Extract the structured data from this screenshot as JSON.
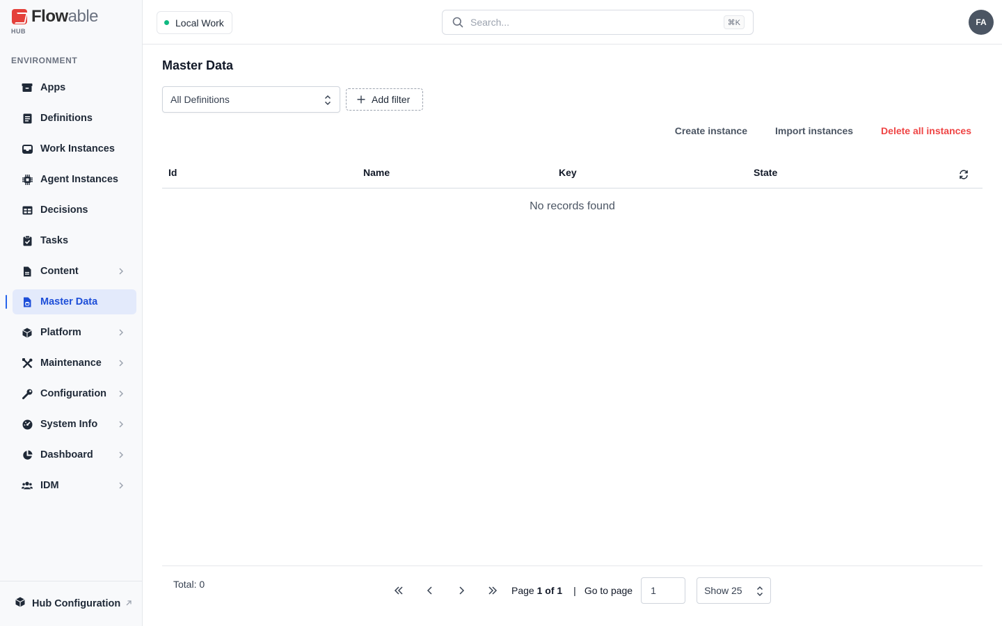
{
  "brand": {
    "name_part1": "Flow",
    "name_part2": "able",
    "sub": "HUB"
  },
  "sidebar": {
    "section_label": "ENVIRONMENT",
    "items": [
      {
        "label": "Apps",
        "icon": "box-icon",
        "chevron": false
      },
      {
        "label": "Definitions",
        "icon": "document-list-icon",
        "chevron": false
      },
      {
        "label": "Work Instances",
        "icon": "inbox-icon",
        "chevron": false
      },
      {
        "label": "Agent Instances",
        "icon": "chip-icon",
        "chevron": false
      },
      {
        "label": "Decisions",
        "icon": "table-icon",
        "chevron": false
      },
      {
        "label": "Tasks",
        "icon": "clipboard-check-icon",
        "chevron": false
      },
      {
        "label": "Content",
        "icon": "file-icon",
        "chevron": true
      },
      {
        "label": "Master Data",
        "icon": "database-file-icon",
        "chevron": false,
        "active": true
      },
      {
        "label": "Platform",
        "icon": "cube-icon",
        "chevron": true
      },
      {
        "label": "Maintenance",
        "icon": "tools-icon",
        "chevron": true
      },
      {
        "label": "Configuration",
        "icon": "wrench-icon",
        "chevron": true
      },
      {
        "label": "System Info",
        "icon": "gauge-icon",
        "chevron": true
      },
      {
        "label": "Dashboard",
        "icon": "pie-chart-icon",
        "chevron": true
      },
      {
        "label": "IDM",
        "icon": "users-icon",
        "chevron": true
      }
    ],
    "footer_label": "Hub Configuration"
  },
  "header": {
    "environment": "Local Work",
    "search_placeholder": "Search...",
    "search_shortcut": "⌘K",
    "avatar_initials": "FA"
  },
  "main": {
    "title": "Master Data",
    "definition_select": "All Definitions",
    "add_filter": "Add filter",
    "actions": {
      "create": "Create instance",
      "import": "Import instances",
      "delete_all": "Delete all instances"
    },
    "columns": [
      "Id",
      "Name",
      "Key",
      "State"
    ],
    "empty_message": "No records found",
    "pagination": {
      "total": "Total: 0",
      "page_prefix": "Page",
      "page_value": "1 of 1",
      "separator": "|",
      "goto_label": "Go to page",
      "goto_value": "1",
      "show": "Show 25"
    }
  },
  "colors": {
    "accent": "#2563eb",
    "danger": "#ef4444",
    "status_online": "#10b981",
    "brand": "#e4403a"
  }
}
